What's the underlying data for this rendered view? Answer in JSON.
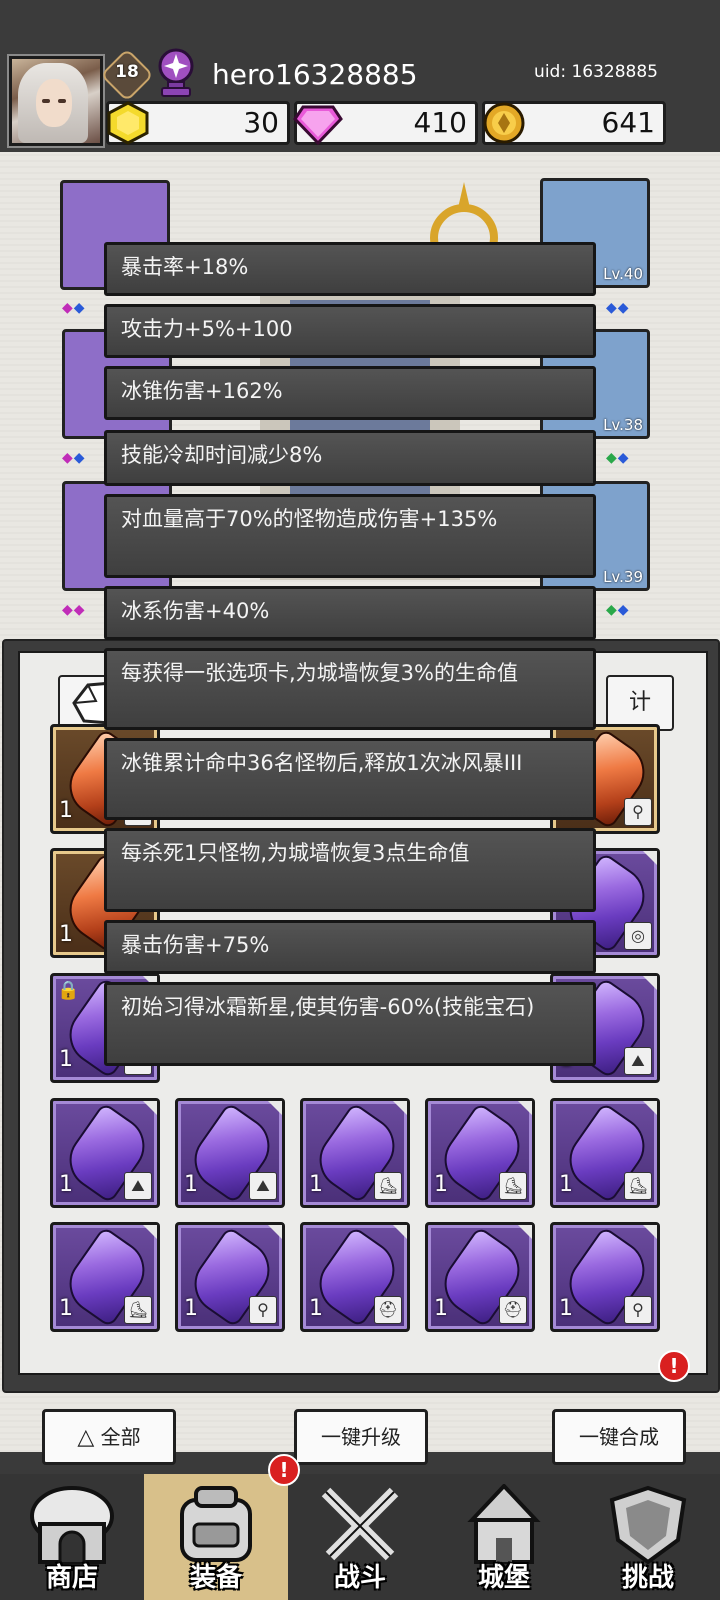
{
  "player": {
    "level": "18",
    "name": "hero16328885",
    "uid": "uid: 16328885"
  },
  "resources": [
    {
      "name": "gold-hexagon",
      "value": "30",
      "color": "#f2d22a"
    },
    {
      "name": "diamond",
      "value": "410",
      "color": "#e457d8"
    },
    {
      "name": "coin",
      "value": "641",
      "color": "#e6ac2a"
    }
  ],
  "equipment_slots": [
    {
      "lv": ""
    },
    {
      "lv": "Lv.40"
    },
    {
      "lv": "Lv.38"
    },
    {
      "lv": "Lv.39"
    }
  ],
  "panel": {
    "stats_tab": "计"
  },
  "tooltip": {
    "lines": [
      "暴击率+18%",
      "攻击力+5%+100",
      "冰锥伤害+162%",
      "技能冷却时间减少8%",
      "对血量高于70%的怪物造成伤害+135%",
      "冰系伤害+40%",
      "每获得一张选项卡,为城墙恢复3%的生命值",
      "冰锥累计命中36名怪物后,释放1次冰风暴III",
      "每杀死1只怪物,为城墙恢复3点生命值",
      "暴击伤害+75%",
      "初始习得冰霜新星,使其伤害-60%(技能宝石)"
    ]
  },
  "gems": {
    "count": "1",
    "rows": [
      [
        "orange",
        "",
        "",
        "",
        "orange"
      ],
      [
        "orange",
        "",
        "",
        "",
        "purple"
      ],
      [
        "purple",
        "",
        "",
        "",
        "purple"
      ],
      [
        "purple",
        "purple",
        "purple",
        "purple",
        "purple"
      ],
      [
        "purple",
        "purple",
        "purple",
        "purple",
        "purple"
      ]
    ]
  },
  "buttons": {
    "all": "全部",
    "upgrade": "一键升级",
    "merge": "一键合成",
    "alert": "!"
  },
  "nav": [
    {
      "label": "商店",
      "icon": "shop-icon"
    },
    {
      "label": "装备",
      "icon": "backpack-icon"
    },
    {
      "label": "战斗",
      "icon": "crossed-swords-icon"
    },
    {
      "label": "城堡",
      "icon": "castle-icon"
    },
    {
      "label": "挑战",
      "icon": "shield-icon"
    }
  ]
}
